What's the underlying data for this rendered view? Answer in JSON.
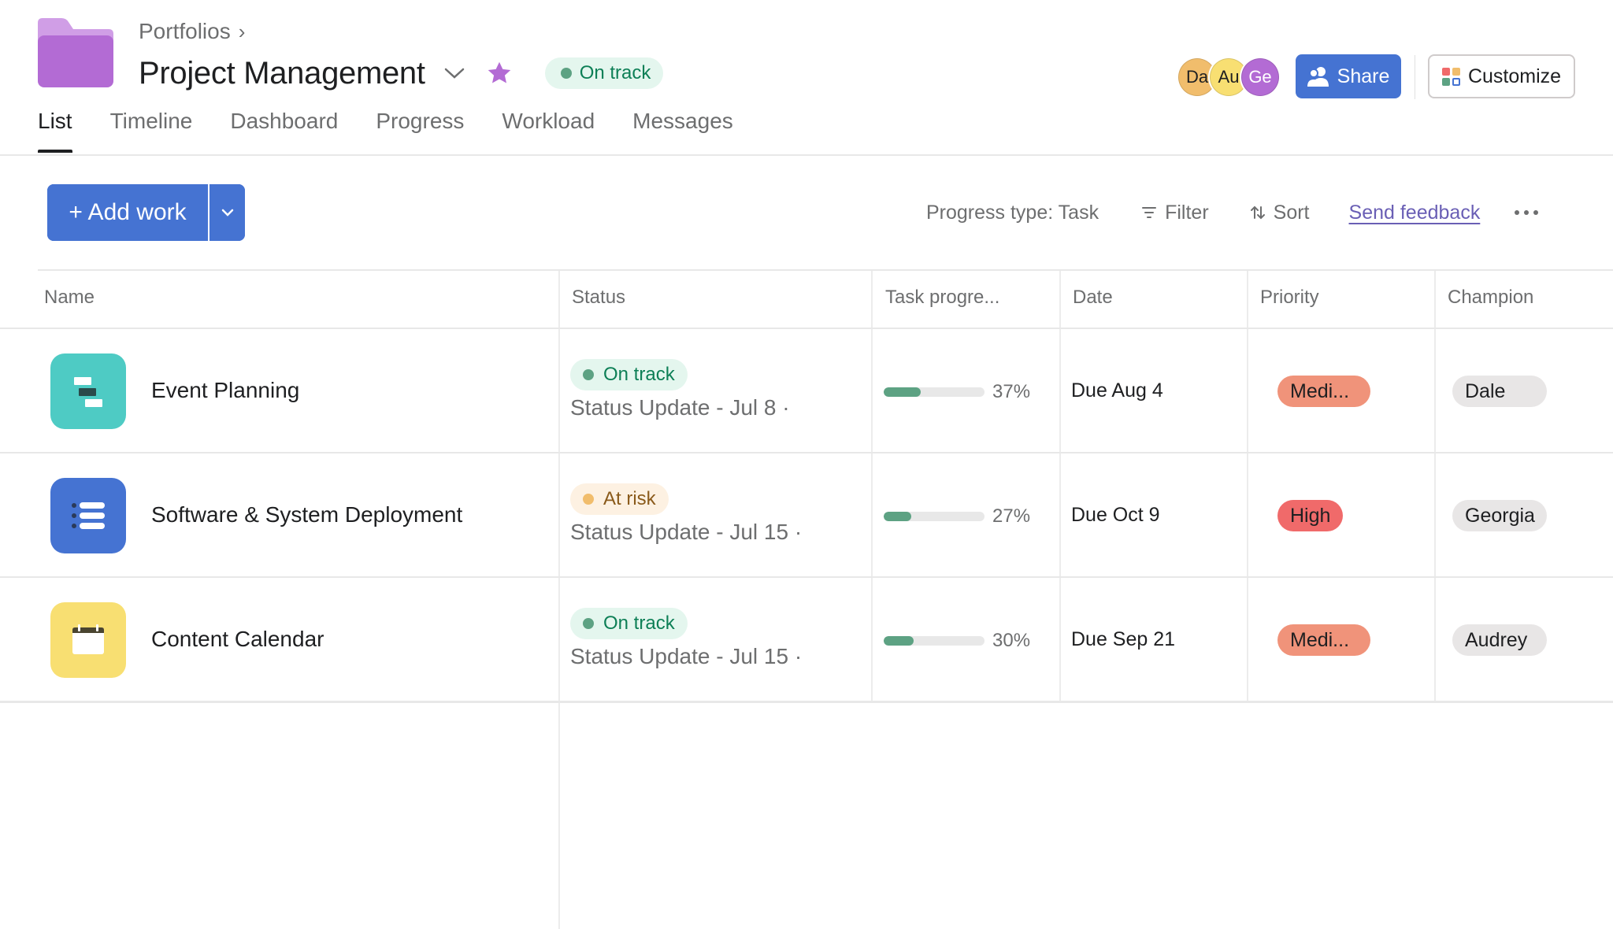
{
  "header": {
    "breadcrumb": "Portfolios",
    "title": "Project Management",
    "status": "On track",
    "colors": {
      "folder": "#b36bd4",
      "star": "#b36bd4",
      "accent": "#4573d2"
    },
    "avatars": [
      {
        "initials": "Da",
        "color": "#f1bd6c"
      },
      {
        "initials": "Au",
        "color": "#f8df72"
      },
      {
        "initials": "Ge",
        "color": "#b36bd4"
      }
    ],
    "share_label": "Share",
    "customize_label": "Customize"
  },
  "tabs": [
    {
      "label": "List",
      "active": true
    },
    {
      "label": "Timeline",
      "active": false
    },
    {
      "label": "Dashboard",
      "active": false
    },
    {
      "label": "Progress",
      "active": false
    },
    {
      "label": "Workload",
      "active": false
    },
    {
      "label": "Messages",
      "active": false
    }
  ],
  "toolbar": {
    "add_work_label": "+ Add work",
    "progress_type": "Progress type: Task",
    "filter_label": "Filter",
    "sort_label": "Sort",
    "feedback_label": "Send feedback"
  },
  "table": {
    "columns": [
      "Name",
      "Status",
      "Task progre...",
      "Date",
      "Priority",
      "Champion"
    ],
    "rows": [
      {
        "name": "Event Planning",
        "icon": "timeline-icon",
        "icon_color": "#4ecbc4",
        "status": "On track",
        "status_kind": "on-track",
        "status_update": "Status Update - Jul 8 ·",
        "progress_percent": 37,
        "progress_label": "37%",
        "date": "Due Aug 4",
        "priority": "Medi...",
        "priority_kind": "medium",
        "champion": "Dale"
      },
      {
        "name": "Software & System Deployment",
        "icon": "list-icon",
        "icon_color": "#4573d2",
        "status": "At risk",
        "status_kind": "at-risk",
        "status_update": "Status Update - Jul 15 ·",
        "progress_percent": 27,
        "progress_label": "27%",
        "date": "Due Oct 9",
        "priority": "High",
        "priority_kind": "high",
        "champion": "Georgia"
      },
      {
        "name": "Content Calendar",
        "icon": "calendar-icon",
        "icon_color": "#f8df72",
        "status": "On track",
        "status_kind": "on-track",
        "status_update": "Status Update - Jul 15 ·",
        "progress_percent": 30,
        "progress_label": "30%",
        "date": "Due Sep 21",
        "priority": "Medi...",
        "priority_kind": "medium",
        "champion": "Audrey"
      }
    ]
  }
}
